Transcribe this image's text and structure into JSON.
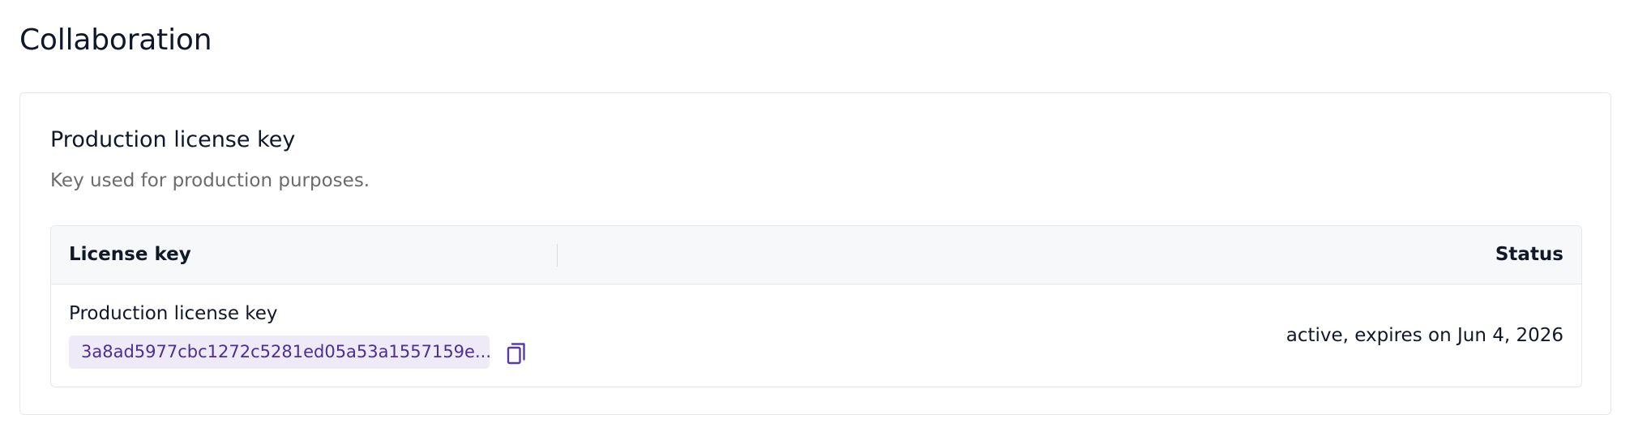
{
  "page": {
    "title": "Collaboration"
  },
  "card": {
    "title": "Production license key",
    "description": "Key used for production purposes."
  },
  "table": {
    "columns": {
      "key": "License key",
      "status": "Status"
    },
    "rows": [
      {
        "name": "Production license key",
        "key": "3a8ad5977cbc1272c5281ed05a53a1557159e...",
        "status": "active, expires on Jun 4, 2026"
      }
    ]
  },
  "icons": {
    "copy": "copy-icon"
  },
  "colors": {
    "accent": "#5b3aa6",
    "chip_background": "#efeaf8",
    "header_background": "#f7f8fa",
    "border": "#e5e7eb",
    "muted_text": "#6b6b6b"
  }
}
